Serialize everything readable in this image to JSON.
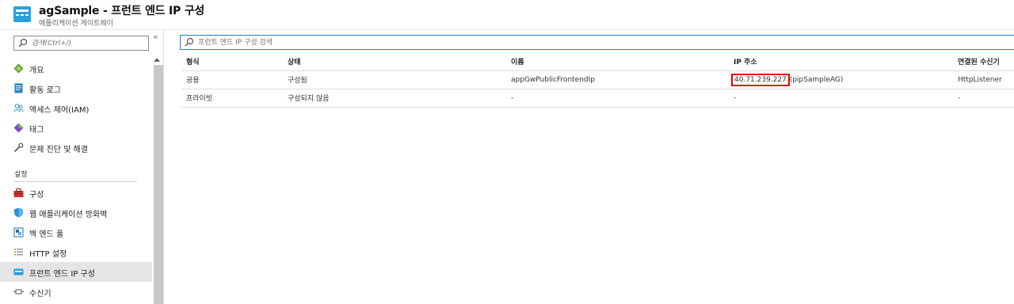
{
  "header": {
    "title": "agSample - 프런트 엔드 IP 구성",
    "subtitle": "애플리케이션 게이트웨이",
    "icon": "application-gateway-icon"
  },
  "sidebar": {
    "search_placeholder": "검색(Ctrl+/)",
    "collapse_label": "«",
    "items": [
      {
        "label": "개요",
        "icon": "overview-icon"
      },
      {
        "label": "활동 로그",
        "icon": "activity-log-icon"
      },
      {
        "label": "액세스 제어(IAM)",
        "icon": "iam-icon"
      },
      {
        "label": "태그",
        "icon": "tag-icon"
      },
      {
        "label": "문제 진단 및 해결",
        "icon": "wrench-icon"
      }
    ],
    "section_label": "설정",
    "settings_items": [
      {
        "label": "구성",
        "icon": "toolbox-icon"
      },
      {
        "label": "웹 애플리케이션 방화벽",
        "icon": "firewall-shield-icon"
      },
      {
        "label": "백 엔드 풀",
        "icon": "backend-pool-icon"
      },
      {
        "label": "HTTP 설정",
        "icon": "http-settings-icon"
      },
      {
        "label": "프런트 엔드 IP 구성",
        "icon": "frontend-ip-icon",
        "selected": true
      },
      {
        "label": "수신기",
        "icon": "listener-icon"
      }
    ]
  },
  "main": {
    "filter_placeholder": "프런트 엔드 IP 구성 검색",
    "columns": [
      "형식",
      "상태",
      "이름",
      "IP 주소",
      "연결된 수신기"
    ],
    "rows": [
      {
        "type": "공용",
        "status": "구성됨",
        "name": "appGwPublicFrontendIp",
        "ip_highlight": "40.71.239.227",
        "ip_rest": " (pipSampleAG)",
        "listener": "HttpListener"
      },
      {
        "type": "프라이빗",
        "status": "구성되지 않음",
        "name": "-",
        "ip_highlight": "",
        "ip_rest": "-",
        "listener": "-"
      }
    ]
  },
  "colors": {
    "accent": "#1f7fd6",
    "highlight": "#e00000",
    "selected_bg": "#e5e5e5"
  }
}
